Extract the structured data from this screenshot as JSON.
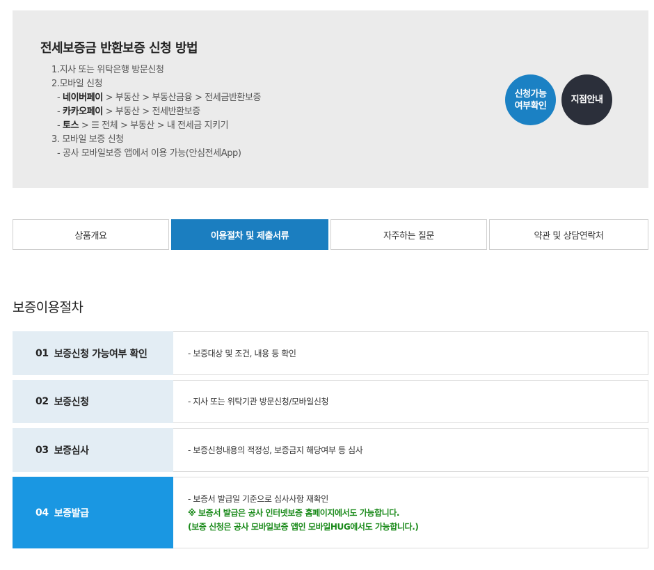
{
  "info": {
    "title": "전세보증금 반환보증 신청 방법",
    "line1": "1.지사 또는 위탁은행 방문신청",
    "line2": "2.모바일 신청",
    "naver_prefix": "- ",
    "naver_name": "네이버페이",
    "naver_path": " > 부동산 > 부동산금융 > 전세금반환보증",
    "kakao_prefix": "- ",
    "kakao_name": "카카오페이",
    "kakao_path": " > 부동산 > 전세반환보증",
    "toss_prefix": "- ",
    "toss_name": "토스",
    "toss_path": " > ☰ 전체 > 부동산 > 내 전세금 지키기",
    "line3": "3. 모바일 보증 신청",
    "line4": "- 공사 모바일보증 앱에서 이용 가능(안심전세App)",
    "btn_check": "신청가능\n여부확인",
    "btn_branch": "지점안내"
  },
  "tabs": [
    {
      "label": "상품개요"
    },
    {
      "label": "이용절차 및 제출서류"
    },
    {
      "label": "자주하는 질문"
    },
    {
      "label": "약관 및 상담연락처"
    }
  ],
  "section_title": "보증이용절차",
  "steps": [
    {
      "num": "01",
      "title": "보증신청 가능여부 확인",
      "lines": [
        "- 보증대상 및 조건, 내용 등 확인"
      ]
    },
    {
      "num": "02",
      "title": "보증신청",
      "lines": [
        "- 지사 또는 위탁기관  방문신청/모바일신청"
      ]
    },
    {
      "num": "03",
      "title": "보증심사",
      "lines": [
        "- 보증신청내용의 적정성, 보증금지 해당여부 등 심사"
      ]
    },
    {
      "num": "04",
      "title": "보증발급",
      "lines": [
        "- 보증서 발급일 기준으로 심사사항 재확인",
        " ※ 보증서 발급은 공사 인터넷보증 홈페이지에서도 가능합니다.",
        "(보증 신청은 공사 모바일보증 앱인 모바일HUG에서도 가능합니다.)"
      ]
    }
  ],
  "colors": {
    "active_tab": "#1b7ec0",
    "step_head": "#e3edf4",
    "step_active": "#1a97e2",
    "notice_green": "#1a8a1a",
    "circle_blue": "#1b81c4",
    "circle_dark": "#2b2f3a"
  }
}
